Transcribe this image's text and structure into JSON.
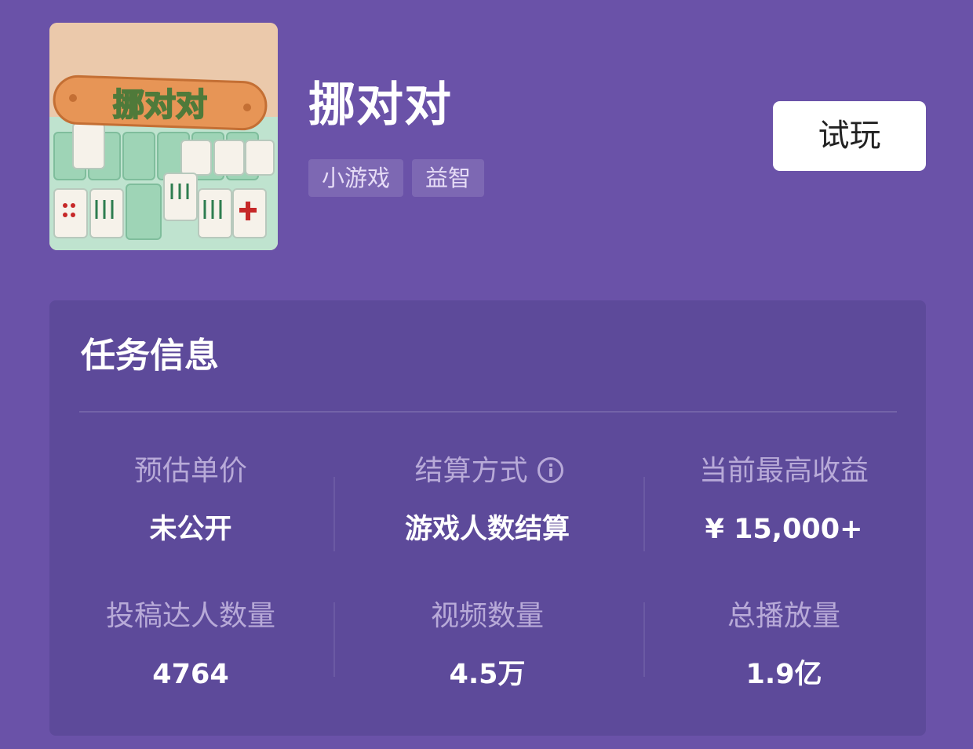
{
  "game": {
    "thumbnail_icon": "mahjong-game-icon",
    "thumbnail_text": "挪对对",
    "title": "挪对对",
    "tags": [
      "小游戏",
      "益智"
    ]
  },
  "try_button": {
    "label": "试玩"
  },
  "task_info": {
    "heading": "任务信息",
    "stats": [
      {
        "label": "预估单价",
        "value": "未公开"
      },
      {
        "label": "结算方式",
        "value": "游戏人数结算",
        "icon": "info-icon"
      },
      {
        "label": "当前最高收益",
        "value": "¥ 15,000+"
      },
      {
        "label": "投稿达人数量",
        "value": "4764"
      },
      {
        "label": "视频数量",
        "value": "4.5万"
      },
      {
        "label": "总播放量",
        "value": "1.9亿"
      }
    ]
  },
  "colors": {
    "background": "#6a52a8",
    "card": "#5d4a9a",
    "button_bg": "#ffffff",
    "label_text": "#b8aad8"
  }
}
